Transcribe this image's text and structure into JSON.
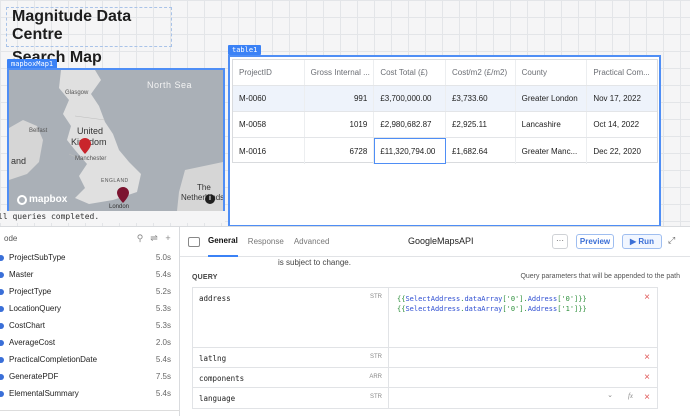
{
  "canvas": {
    "app_title": "Magnitude Data Centre",
    "section_title": "Search Map",
    "map_tag": "mapboxMap1",
    "table_tag": "table1",
    "status_text": "ll queries completed."
  },
  "map": {
    "sea_label": "North Sea",
    "labels": {
      "glasgow": "Glasgow",
      "belfast": "Belfast",
      "uk_line1": "United",
      "uk_line2": "Kingdom",
      "manchester": "Manchester",
      "england": "ENGLAND",
      "london": "London",
      "ireland_partial": "and",
      "nl_line1": "The",
      "nl_line2": "Netherlands"
    },
    "logo": "mapbox",
    "info": "i",
    "pin_color": "#c9252c",
    "pin_color_dark": "#7c1430"
  },
  "table": {
    "columns": [
      "ProjectID",
      "Gross Internal ...",
      "Cost Total (£)",
      "Cost/m2 (£/m2)",
      "County",
      "Practical Com..."
    ],
    "rows": [
      [
        "M-0060",
        "991",
        "£3,700,000.00",
        "£3,733.60",
        "Greater London",
        "Nov 17, 2022"
      ],
      [
        "M-0058",
        "1019",
        "£2,980,682.87",
        "£2,925.11",
        "Lancashire",
        "Oct 14, 2022"
      ],
      [
        "M-0016",
        "6728",
        "£11,320,794.00",
        "£1,682.64",
        "Greater Manc...",
        "Dec 22, 2020"
      ]
    ]
  },
  "queries": {
    "header_label": "ode",
    "items": [
      {
        "name": "ProjectSubType",
        "time": "5.0s"
      },
      {
        "name": "Master",
        "time": "5.4s"
      },
      {
        "name": "ProjectType",
        "time": "5.2s"
      },
      {
        "name": "LocationQuery",
        "time": "5.3s"
      },
      {
        "name": "CostChart",
        "time": "5.3s"
      },
      {
        "name": "AverageCost",
        "time": "2.0s"
      },
      {
        "name": "PracticalCompletionDate",
        "time": "5.4s"
      },
      {
        "name": "GeneratePDF",
        "time": "7.5s"
      },
      {
        "name": "ElementalSummary",
        "time": "5.4s"
      }
    ]
  },
  "editor": {
    "tabs": [
      "General",
      "Response",
      "Advanced"
    ],
    "query_name": "GoogleMapsAPI",
    "more": "···",
    "preview": "Preview",
    "run": "Run",
    "notice": "is subject to change.",
    "section": "QUERY",
    "hint": "Query parameters that will be appended to the path",
    "params": [
      {
        "key": "address",
        "type": "STR",
        "line1": "{{SelectAddress.dataArray['0'].Address['0']}}",
        "line2": "{{SelectAddress.dataArray['0'].Address['1']}}"
      },
      {
        "key": "latlng",
        "type": "STR",
        "line1": "",
        "line2": ""
      },
      {
        "key": "components",
        "type": "ARR",
        "line1": "",
        "line2": ""
      },
      {
        "key": "language",
        "type": "STR",
        "line1": "",
        "line2": ""
      }
    ]
  }
}
